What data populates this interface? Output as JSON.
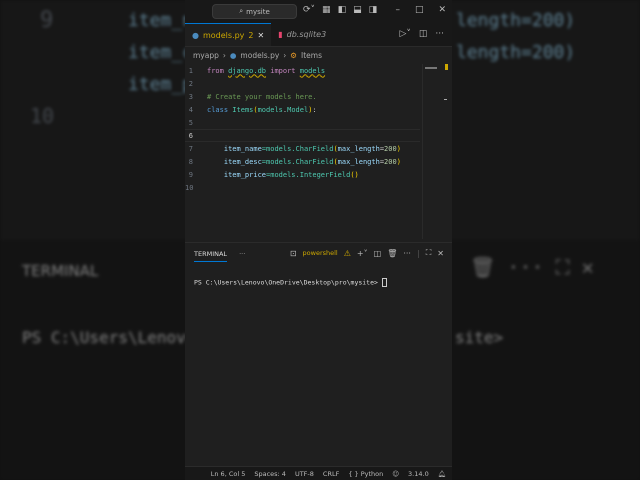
{
  "background": {
    "lines": [
      "item_n",
      "item_c",
      "item_p",
      "10"
    ],
    "right": [
      "length=200)",
      "length=200)"
    ],
    "terminal": "TERMINAL",
    "prompt_left": "PS C:\\Users\\Lenovo",
    "prompt_right": "site>"
  },
  "titlebar": {
    "search": "mysite"
  },
  "tabs": [
    {
      "label": "models.py",
      "badge": "2",
      "active": true
    },
    {
      "label": "db.sqlite3",
      "active": false
    }
  ],
  "breadcrumb": [
    "myapp",
    "models.py",
    "Items"
  ],
  "code": {
    "numbers": [
      "1",
      "2",
      "3",
      "4",
      "5",
      "6",
      "7",
      "8",
      "9",
      "10"
    ],
    "l1": {
      "a": "from",
      "b": "django.db",
      "c": "import",
      "d": "models"
    },
    "l3": "# Create your models here.",
    "l4": {
      "a": "class",
      "b": "Items",
      "c": "(",
      "d": "models",
      "e": ".",
      "f": "Model",
      "g": ")",
      ":": ":"
    },
    "l7": {
      "a": "item_name",
      "b": "=models.",
      "c": "CharField",
      "d": "max_length",
      "e": "200"
    },
    "l8": {
      "a": "item_desc",
      "b": "=models.",
      "c": "CharField",
      "d": "max_length",
      "e": "200"
    },
    "l9": {
      "a": "item_price",
      "b": "=models.",
      "c": "IntegerField"
    }
  },
  "panel": {
    "tab": "TERMINAL",
    "more": "···",
    "shell": "powershell",
    "prompt": "PS C:\\Users\\Lenovo\\OneDrive\\Desktop\\pro\\mysite> "
  },
  "status": {
    "position": "Ln 6, Col 5",
    "spaces": "Spaces: 4",
    "encoding": "UTF-8",
    "eol": "CRLF",
    "language": "Python",
    "version": "3.14.0"
  }
}
